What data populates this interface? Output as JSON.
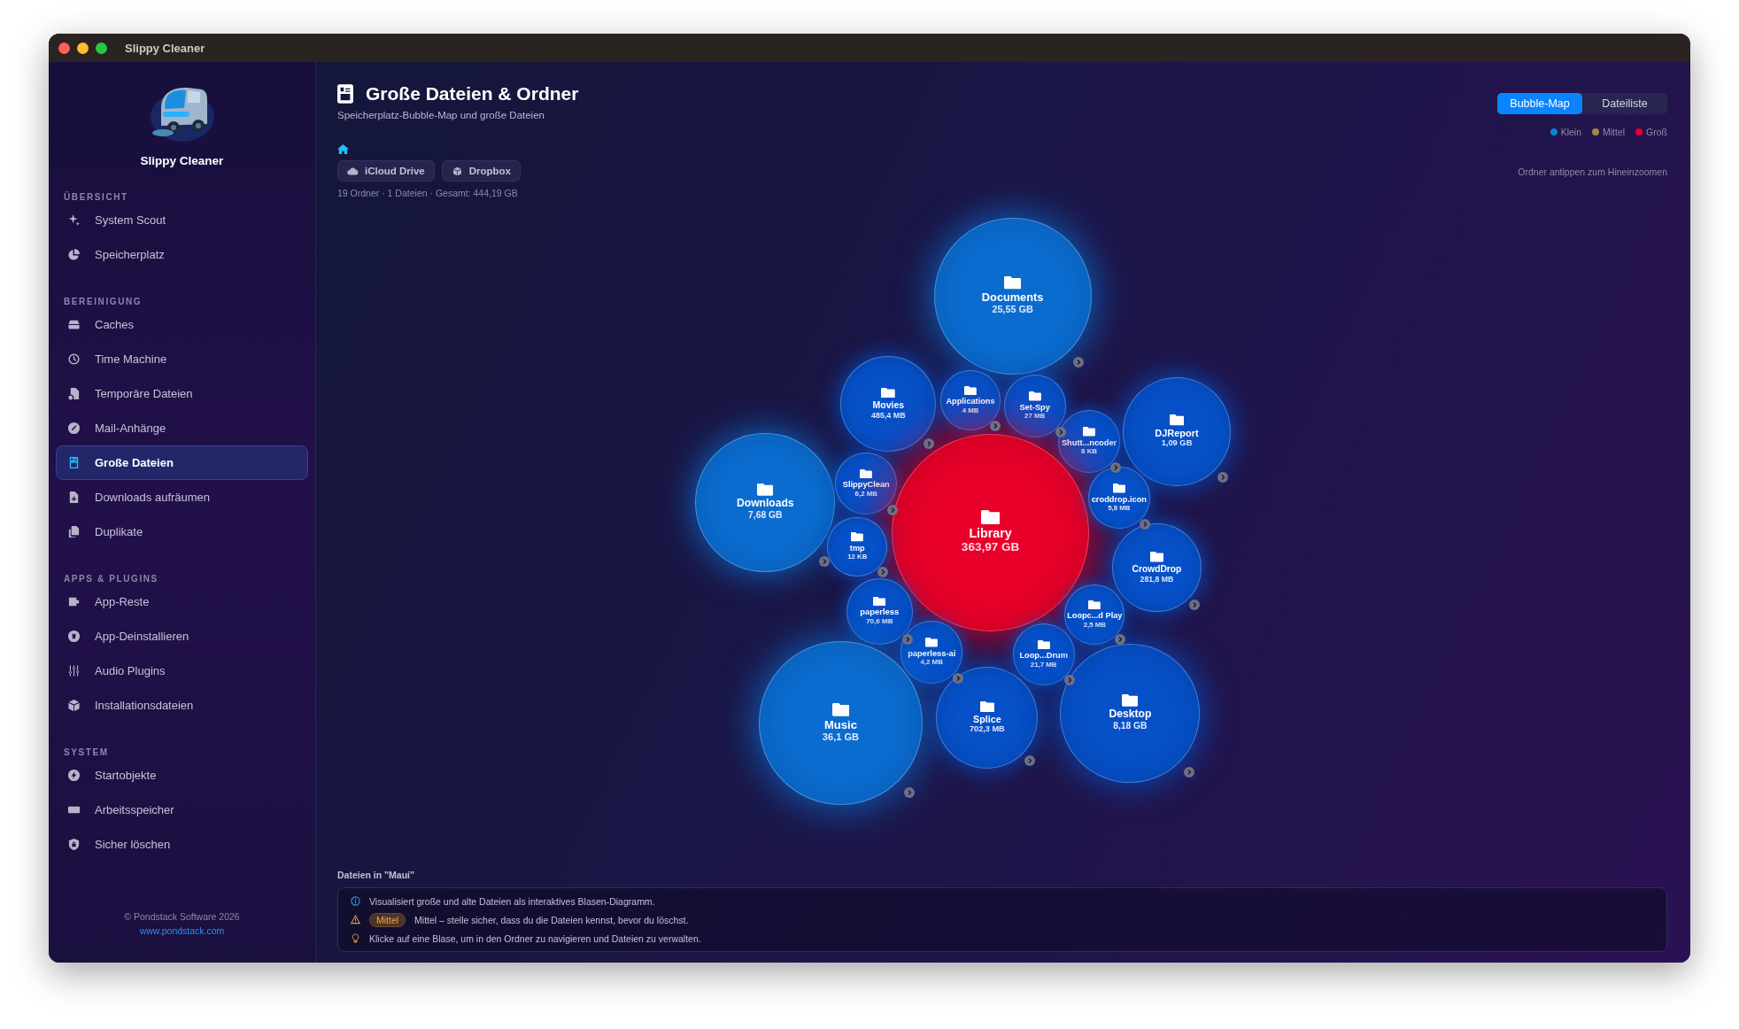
{
  "window": {
    "title": "Slippy Cleaner"
  },
  "sidebar": {
    "app_name": "Slippy Cleaner",
    "sections": [
      {
        "title": "ÜBERSICHT",
        "items": [
          {
            "label": "System Scout",
            "selected": false
          },
          {
            "label": "Speicherplatz",
            "selected": false
          }
        ]
      },
      {
        "title": "BEREINIGUNG",
        "items": [
          {
            "label": "Caches",
            "selected": false
          },
          {
            "label": "Time Machine",
            "selected": false
          },
          {
            "label": "Temporäre Dateien",
            "selected": false
          },
          {
            "label": "Mail-Anhänge",
            "selected": false
          },
          {
            "label": "Große Dateien",
            "selected": true
          },
          {
            "label": "Downloads aufräumen",
            "selected": false
          },
          {
            "label": "Duplikate",
            "selected": false
          }
        ]
      },
      {
        "title": "APPS & PLUGINS",
        "items": [
          {
            "label": "App-Reste",
            "selected": false
          },
          {
            "label": "App-Deinstallieren",
            "selected": false
          },
          {
            "label": "Audio Plugins",
            "selected": false
          },
          {
            "label": "Installationsdateien",
            "selected": false
          }
        ]
      },
      {
        "title": "SYSTEM",
        "items": [
          {
            "label": "Startobjekte",
            "selected": false
          },
          {
            "label": "Arbeitsspeicher",
            "selected": false
          },
          {
            "label": "Sicher löschen",
            "selected": false
          }
        ]
      }
    ],
    "footer": {
      "copyright": "© Pondstack Software 2026",
      "link": "www.pondstack.com"
    }
  },
  "header": {
    "title": "Große Dateien & Ordner",
    "subtitle": "Speicherplatz-Bubble-Map und große Dateien"
  },
  "view_tabs": [
    {
      "label": "Bubble-Map",
      "selected": true
    },
    {
      "label": "Dateiliste",
      "selected": false
    }
  ],
  "legend": [
    {
      "label": "Klein",
      "color": "#0a84d6"
    },
    {
      "label": "Mittel",
      "color": "#a08a4a"
    },
    {
      "label": "Groß",
      "color": "#e8002a"
    }
  ],
  "locations": [
    {
      "label": "iCloud Drive",
      "kind": "cloud"
    },
    {
      "label": "Dropbox",
      "kind": "box"
    }
  ],
  "stats": "19 Ordner · 1 Dateien · Gesamt: 444,19 GB",
  "hint": "Ordner antippen zum Hineinzoomen",
  "bubbles": [
    {
      "name": "Documents",
      "size": "25,55 GB",
      "color": "#0b6cd0",
      "expandable": true
    },
    {
      "name": "Movies",
      "size": "485,4 MB",
      "color": "#0650c8",
      "expandable": true
    },
    {
      "name": "Applications",
      "size": "4 MB",
      "color": "#0650c8",
      "expandable": true
    },
    {
      "name": "Set-Spy",
      "size": "27 MB",
      "color": "#0650c8",
      "expandable": true
    },
    {
      "name": "Shutt...ncoder",
      "size": "8 KB",
      "color": "#0650c8",
      "expandable": true
    },
    {
      "name": "DJReport",
      "size": "1,09 GB",
      "color": "#0650c8",
      "expandable": true
    },
    {
      "name": "Downloads",
      "size": "7,68 GB",
      "color": "#0b6cd0",
      "expandable": true
    },
    {
      "name": "SlippyClean",
      "size": "6,2 MB",
      "color": "#0650c8",
      "expandable": true
    },
    {
      "name": "Library",
      "size": "363,97 GB",
      "color": "#e8002a",
      "expandable": false
    },
    {
      "name": "croddrop.icon",
      "size": "5,8 MB",
      "color": "#0650c8",
      "expandable": true
    },
    {
      "name": "tmp",
      "size": "12 KB",
      "color": "#0650c8",
      "expandable": true
    },
    {
      "name": "CrowdDrop",
      "size": "281,8 MB",
      "color": "#0650c8",
      "expandable": true
    },
    {
      "name": "paperless",
      "size": "70,6 MB",
      "color": "#0650c8",
      "expandable": true
    },
    {
      "name": "Loopc...d Play",
      "size": "2,5 MB",
      "color": "#0650c8",
      "expandable": true
    },
    {
      "name": "paperless-ai",
      "size": "4,2 MB",
      "color": "#0650c8",
      "expandable": true
    },
    {
      "name": "Loop...Drum",
      "size": "21,7 MB",
      "color": "#0650c8",
      "expandable": true
    },
    {
      "name": "Music",
      "size": "36,1 GB",
      "color": "#0b6cd0",
      "expandable": true
    },
    {
      "name": "Splice",
      "size": "702,3 MB",
      "color": "#0650c8",
      "expandable": true
    },
    {
      "name": "Desktop",
      "size": "8,18 GB",
      "color": "#0650c8",
      "expandable": true
    }
  ],
  "files_heading": "Dateien in \"Maui\"",
  "notes": [
    {
      "kind": "info",
      "text": "Visualisiert große und alte Dateien als interaktives Blasen-Diagramm."
    },
    {
      "kind": "warning",
      "badge": "Mittel",
      "text": "Mittel – stelle sicher, dass du die Dateien kennst, bevor du löschst."
    },
    {
      "kind": "tip",
      "text": "Klicke auf eine Blase, um in den Ordner zu navigieren und Dateien zu verwalten."
    }
  ]
}
